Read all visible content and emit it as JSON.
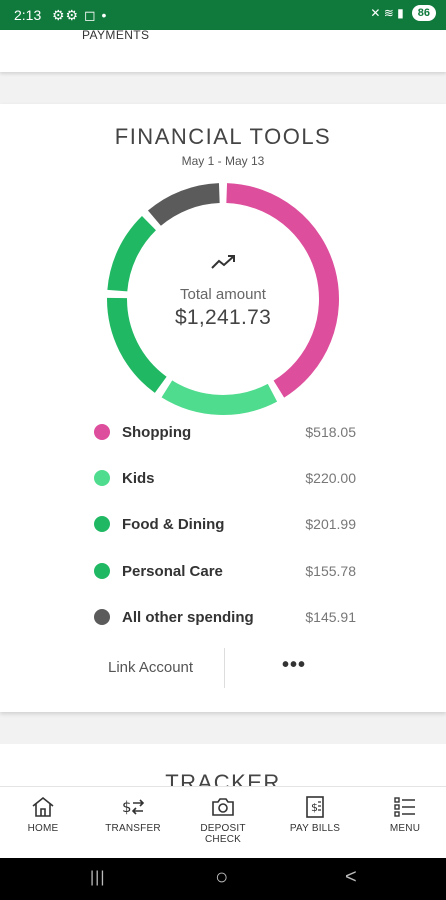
{
  "status_bar": {
    "time": "2:13",
    "left_icons": "⚙⚙ ◻ •",
    "right_icons": "✕ ≋ ▮",
    "battery": "86"
  },
  "top_card": {
    "label": "PAYMENTS"
  },
  "financial_tools": {
    "title": "FINANCIAL TOOLS",
    "date_range": "May 1 - May 13",
    "total_label": "Total amount",
    "total_value": "$1,241.73",
    "categories": [
      {
        "name": "Shopping",
        "amount": "$518.05",
        "value": 518.05,
        "color": "#dd4e9c"
      },
      {
        "name": "Kids",
        "amount": "$220.00",
        "value": 220.0,
        "color": "#4fdc8e"
      },
      {
        "name": "Food & Dining",
        "amount": "$201.99",
        "value": 201.99,
        "color": "#21b864"
      },
      {
        "name": "Personal Care",
        "amount": "$155.78",
        "value": 155.78,
        "color": "#21b864"
      },
      {
        "name": "All other spending",
        "amount": "$145.91",
        "value": 145.91,
        "color": "#5b5b5b"
      }
    ],
    "link_account": "Link Account",
    "more": "•••"
  },
  "tracker": {
    "title": "TRACKER"
  },
  "bottom_nav": [
    {
      "id": "home",
      "label": "HOME",
      "icon": "home-icon"
    },
    {
      "id": "transfer",
      "label": "TRANSFER",
      "icon": "transfer-icon"
    },
    {
      "id": "deposit",
      "label": "DEPOSIT CHECK",
      "icon": "camera-icon"
    },
    {
      "id": "paybills",
      "label": "PAY BILLS",
      "icon": "bill-icon"
    },
    {
      "id": "menu",
      "label": "MENU",
      "icon": "menu-list-icon"
    }
  ],
  "system_nav": {
    "recents": "|||",
    "home": "○",
    "back": "<"
  }
}
